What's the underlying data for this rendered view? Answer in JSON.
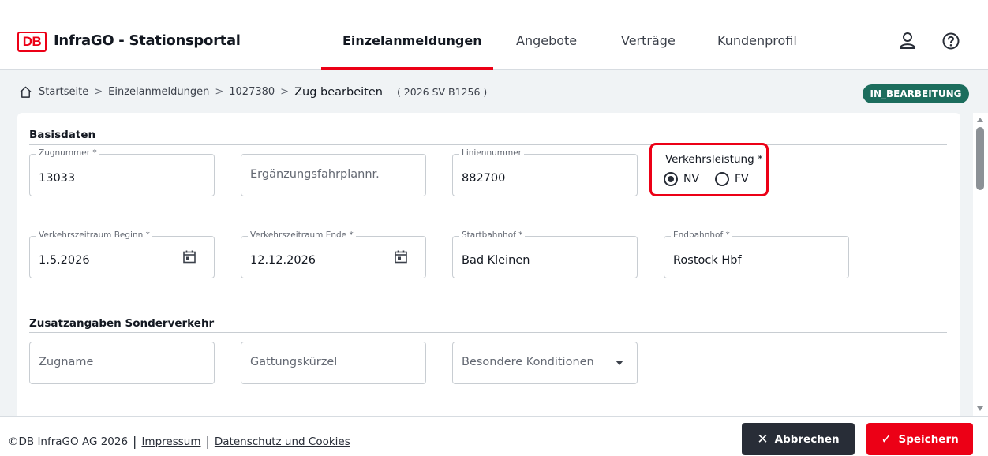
{
  "header": {
    "logo": "DB",
    "app_title": "InfraGO - Stationsportal",
    "nav": [
      "Einzelanmeldungen",
      "Angebote",
      "Verträge",
      "Kundenprofil"
    ],
    "active_nav": "Einzelanmeldungen",
    "icons": [
      "user-icon",
      "help-icon"
    ]
  },
  "breadcrumb": {
    "items": [
      "Startseite",
      "Einzelanmeldungen",
      "1027380"
    ],
    "separator": ">",
    "current": "Zug bearbeiten",
    "code": "( 2026 SV B1256 )",
    "status": "IN_BEARBEITUNG",
    "status_color": "#1c6d5d"
  },
  "basisdaten": {
    "title": "Basisdaten",
    "zugnummer": {
      "label": "Zugnummer *",
      "value": "13033"
    },
    "ergaenzung": {
      "placeholder": "Ergänzungsfahrplannr."
    },
    "liniennummer": {
      "label": "Liniennummer",
      "value": "882700"
    },
    "verkehrsleistung": {
      "label": "Verkehrsleistung *",
      "options": [
        "NV",
        "FV"
      ],
      "selected": "NV"
    },
    "beginn": {
      "label": "Verkehrszeitraum Beginn *",
      "value": "1.5.2026"
    },
    "ende": {
      "label": "Verkehrszeitraum Ende *",
      "value": "12.12.2026"
    },
    "startbahnhof": {
      "label": "Startbahnhof *",
      "value": "Bad Kleinen"
    },
    "endbahnhof": {
      "label": "Endbahnhof *",
      "value": "Rostock Hbf"
    }
  },
  "sonderverkehr": {
    "title": "Zusatzangaben Sonderverkehr",
    "zugname": {
      "placeholder": "Zugname"
    },
    "gattung": {
      "placeholder": "Gattungskürzel"
    },
    "konditionen": {
      "placeholder": "Besondere Konditionen"
    }
  },
  "footer": {
    "copyright": "©DB InfraGO AG 2026",
    "impressum": "Impressum",
    "datenschutz": "Datenschutz und Cookies",
    "cancel_label": "Abbrechen",
    "save_label": "Speichern",
    "brand_color": "#ec0016"
  }
}
